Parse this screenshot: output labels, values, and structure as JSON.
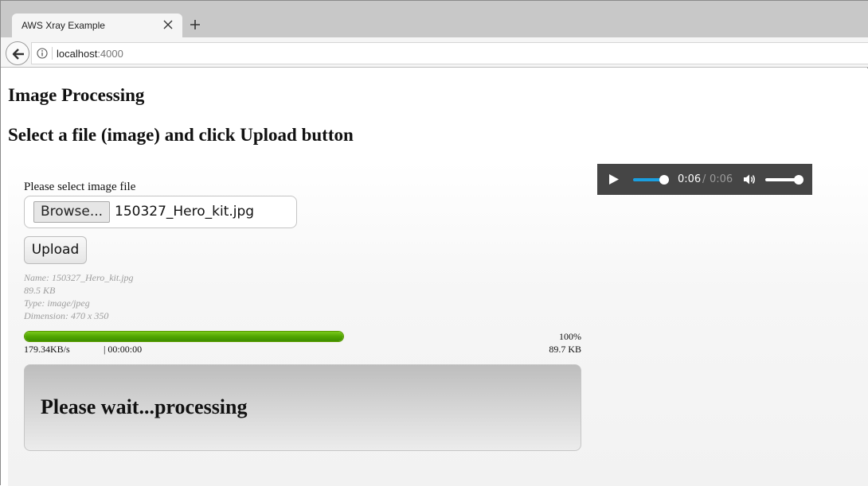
{
  "browser": {
    "tab_title": "AWS Xray Example",
    "url_host": "localhost",
    "url_port": ":4000"
  },
  "page": {
    "title": "Image Processing",
    "subtitle": "Select a file (image) and click Upload button"
  },
  "upload_form": {
    "file_label": "Please select image file",
    "browse_label": "Browse...",
    "file_name": "150327_Hero_kit.jpg",
    "upload_label": "Upload"
  },
  "file_info": {
    "name": "Name: 150327_Hero_kit.jpg",
    "size": "89.5 KB",
    "type": "Type: image/jpeg",
    "dimension": "Dimension: 470 x 350"
  },
  "progress": {
    "percent_value": 100,
    "percent_text": "100%",
    "speed": "179.34KB/s",
    "elapsed": "| 00:00:00",
    "size_uploaded": "89.7 KB",
    "bar_color": "#4ea300"
  },
  "status": {
    "message": "Please wait...processing"
  },
  "audio_player": {
    "current_time": "0:06",
    "separator": "/",
    "total_time": "0:06",
    "seek_fraction": 1.0,
    "volume_fraction": 1.0,
    "accent_color": "#1a9fe0",
    "icons": [
      "play-icon",
      "volume-icon"
    ]
  }
}
